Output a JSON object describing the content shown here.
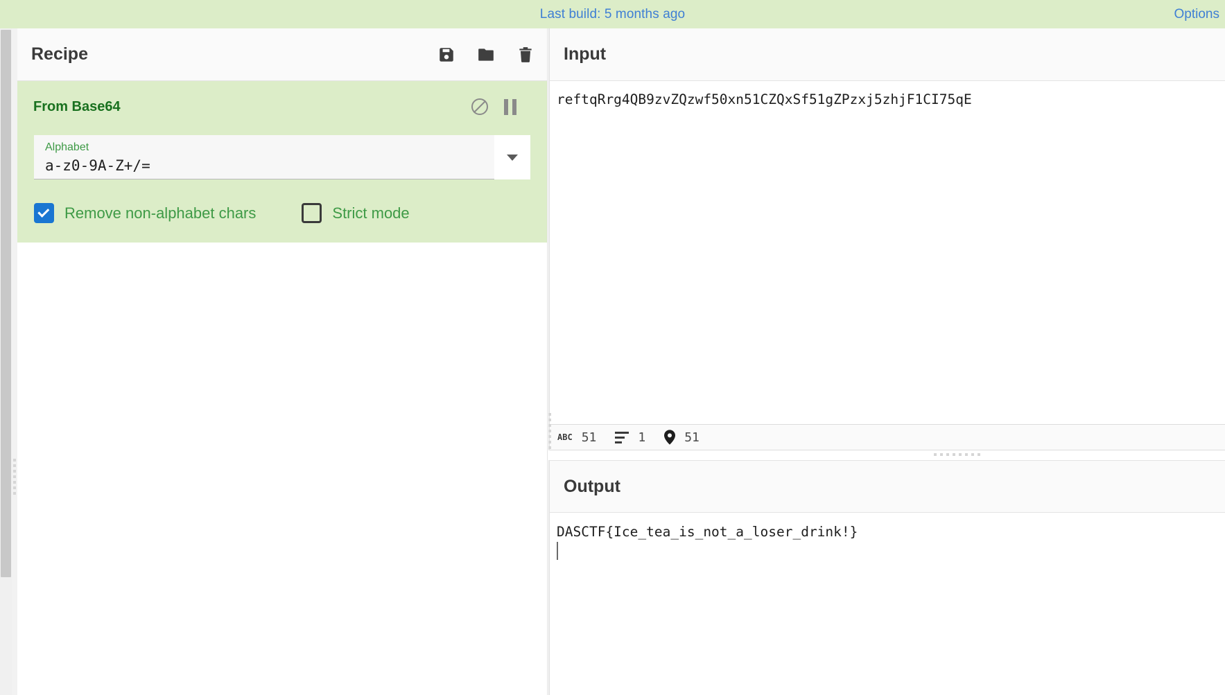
{
  "banner": {
    "build_text": "Last build: 5 months ago",
    "options_label": "Options",
    "link_color": "#3f7fd4",
    "background": "#dcedc8"
  },
  "recipe": {
    "title": "Recipe",
    "icons": [
      {
        "name": "save-icon",
        "label": "Save recipe"
      },
      {
        "name": "folder-icon",
        "label": "Load recipe"
      },
      {
        "name": "trash-icon",
        "label": "Clear recipe"
      }
    ],
    "operation": {
      "title": "From Base64",
      "title_color": "#19711f",
      "background": "#dcedc8",
      "disable_icon": "circle-slash-icon",
      "pause_icon": "pause-icon",
      "argument_alphabet": {
        "label": "Alphabet",
        "value": "a-z0-9A-Z+/=",
        "placeholder": "a-z0-9A-Z+/=",
        "dropdown_icon": "chevron-down-icon"
      },
      "argument_remove_non_alphabet": {
        "label": "Remove non-alphabet chars",
        "checked": true,
        "checked_color": "#1976d2"
      },
      "argument_strict_mode": {
        "label": "Strict mode",
        "checked": false
      }
    }
  },
  "input": {
    "title": "Input",
    "text": "reftqRrg4QB9zvZQzwf50xn51CZQxSf51gZPzxj5zhjF1CI75qE",
    "status": {
      "length_icon": "abc-icon",
      "length": "51",
      "lines_icon": "lines-icon",
      "lines": "1",
      "position_icon": "map-pin-icon",
      "position": "51"
    }
  },
  "output": {
    "title": "Output",
    "text": "DASCTF{Ice_tea_is_not_a_loser_drink!}"
  }
}
